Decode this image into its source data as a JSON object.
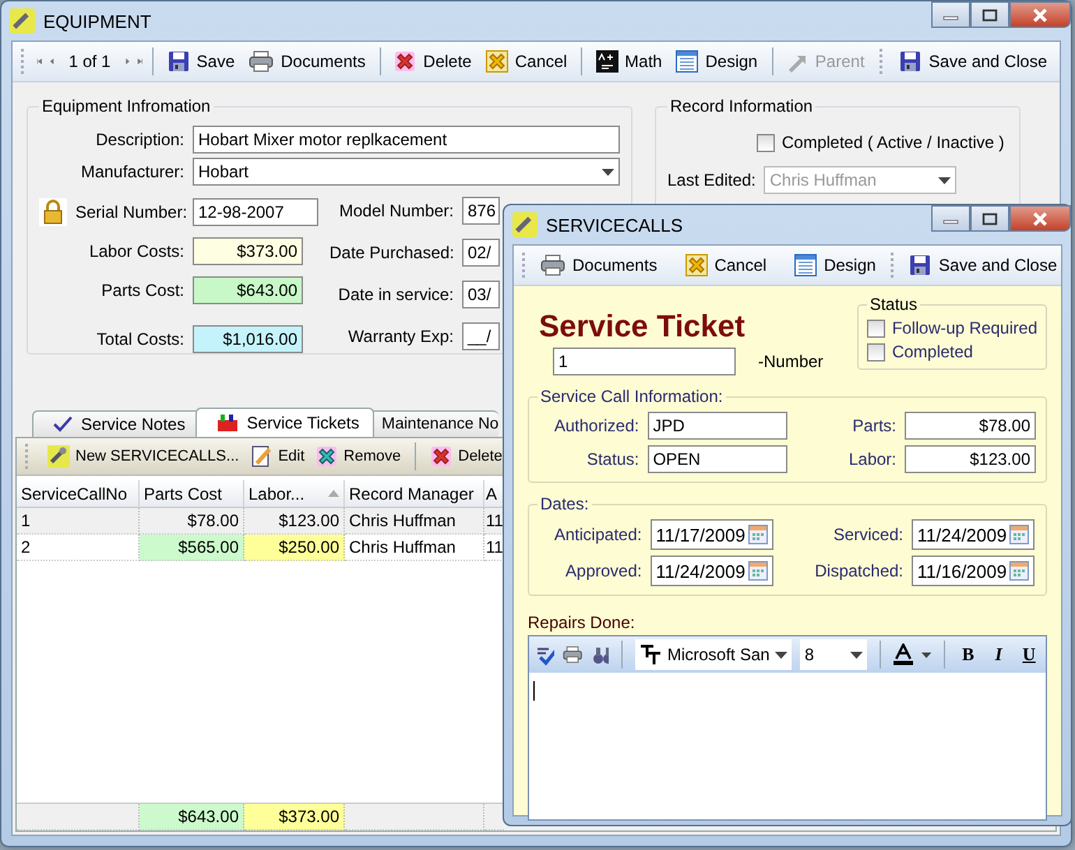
{
  "equipment_window": {
    "title": "EQUIPMENT",
    "toolbar": {
      "position": "1 of 1",
      "buttons": [
        {
          "label": "Save",
          "kind": "save",
          "disabled": false
        },
        {
          "label": "Documents",
          "kind": "print",
          "disabled": false
        },
        {
          "label": "Delete",
          "kind": "delete",
          "disabled": false
        },
        {
          "label": "Cancel",
          "kind": "cancel",
          "disabled": false
        },
        {
          "label": "Math",
          "kind": "math",
          "disabled": false
        },
        {
          "label": "Design",
          "kind": "design",
          "disabled": false
        },
        {
          "label": "Parent",
          "kind": "parent",
          "disabled": true
        },
        {
          "label": "Save and Close",
          "kind": "save",
          "disabled": false
        }
      ]
    },
    "equipment_info": {
      "title": "Equipment Infromation",
      "description": {
        "label": "Description:",
        "value": "Hobart Mixer motor replkacement"
      },
      "manufacturer": {
        "label": "Manufacturer:",
        "value": "Hobart"
      },
      "serial_number": {
        "label": "Serial Number:",
        "value": "12-98-2007",
        "locked": true
      },
      "costs": [
        {
          "label": "Labor Costs:",
          "value": "$373.00",
          "color": "#fefee2"
        },
        {
          "label": "Parts Cost:",
          "value": "$643.00",
          "color": "#c8f7c8"
        },
        {
          "label": "Total Costs:",
          "value": "$1,016.00",
          "color": "#c5f3fb"
        }
      ],
      "dates": [
        {
          "label": "Model Number:",
          "value": "876"
        },
        {
          "label": "Date Purchased:",
          "value": "02/"
        },
        {
          "label": "Date in service:",
          "value": "03/"
        },
        {
          "label": "Warranty Exp:",
          "value": "__/"
        }
      ]
    },
    "record_info": {
      "title": "Record Information",
      "completed": {
        "label": "Completed ( Active / Inactive )",
        "checked": false
      },
      "last_edited": {
        "label": "Last Edited:",
        "value": "Chris Huffman",
        "disabled": true
      }
    },
    "tabs": [
      {
        "label": "Service Notes",
        "kind": "check",
        "selected": false
      },
      {
        "label": "Service Tickets",
        "kind": "toolbox",
        "selected": true
      },
      {
        "label": "Maintenance No",
        "kind": "plain",
        "selected": false
      }
    ],
    "grid_toolbar": [
      {
        "label": "New SERVICECALLS...",
        "kind": "new"
      },
      {
        "label": "Edit",
        "kind": "edit"
      },
      {
        "label": "Remove",
        "kind": "remove"
      },
      {
        "label": "Delete",
        "kind": "delete"
      }
    ],
    "table": {
      "columns": [
        {
          "label": "ServiceCallNo",
          "kind": "text",
          "sorted": false
        },
        {
          "label": "Parts Cost",
          "kind": "money",
          "sorted": false,
          "color": "#ccfacc",
          "total": "$643.00"
        },
        {
          "label": "Labor...",
          "kind": "money",
          "sorted": true,
          "color": "#ffff99",
          "total": "$373.00"
        },
        {
          "label": "Record Manager",
          "kind": "text",
          "sorted": false
        },
        {
          "label": "A",
          "kind": "text",
          "sorted": false
        }
      ],
      "rows": [
        {
          "cells": [
            "1",
            "$78.00",
            "$123.00",
            "Chris Huffman",
            "11"
          ],
          "selected": true
        },
        {
          "cells": [
            "2",
            "$565.00",
            "$250.00",
            "Chris Huffman",
            "11"
          ],
          "selected": false
        }
      ]
    }
  },
  "service_window": {
    "title": "SERVICECALLS",
    "toolbar": [
      {
        "label": "Documents",
        "kind": "print"
      },
      {
        "label": "Cancel",
        "kind": "cancel"
      },
      {
        "label": "Design",
        "kind": "design"
      },
      {
        "label": "Save and Close",
        "kind": "save"
      }
    ],
    "heading": "Service Ticket",
    "number": {
      "value": "1",
      "label": "-Number"
    },
    "status": {
      "title": "Status",
      "options": [
        {
          "label": "Follow-up Required",
          "checked": false
        },
        {
          "label": "Completed",
          "checked": false
        }
      ]
    },
    "call_info": {
      "title": "Service Call Information:",
      "fields": [
        {
          "label": "Authorized:",
          "value": "JPD",
          "kind": "text"
        },
        {
          "label": "Parts:",
          "value": "$78.00",
          "kind": "money"
        },
        {
          "label": "Status:",
          "value": "OPEN",
          "kind": "text"
        },
        {
          "label": "Labor:",
          "value": "$123.00",
          "kind": "money"
        }
      ]
    },
    "dates": {
      "title": "Dates:",
      "fields": [
        {
          "label": "Anticipated:",
          "value": "11/17/2009"
        },
        {
          "label": "Serviced:",
          "value": "11/24/2009"
        },
        {
          "label": "Approved:",
          "value": "11/24/2009"
        },
        {
          "label": "Dispatched:",
          "value": "11/16/2009"
        }
      ]
    },
    "repairs": {
      "label": "Repairs Done:",
      "font": "Microsoft San",
      "size": "8",
      "format_buttons": [
        {
          "label": "B",
          "kind": "bold"
        },
        {
          "label": "I",
          "kind": "italic"
        },
        {
          "label": "U",
          "kind": "underline"
        }
      ]
    }
  }
}
